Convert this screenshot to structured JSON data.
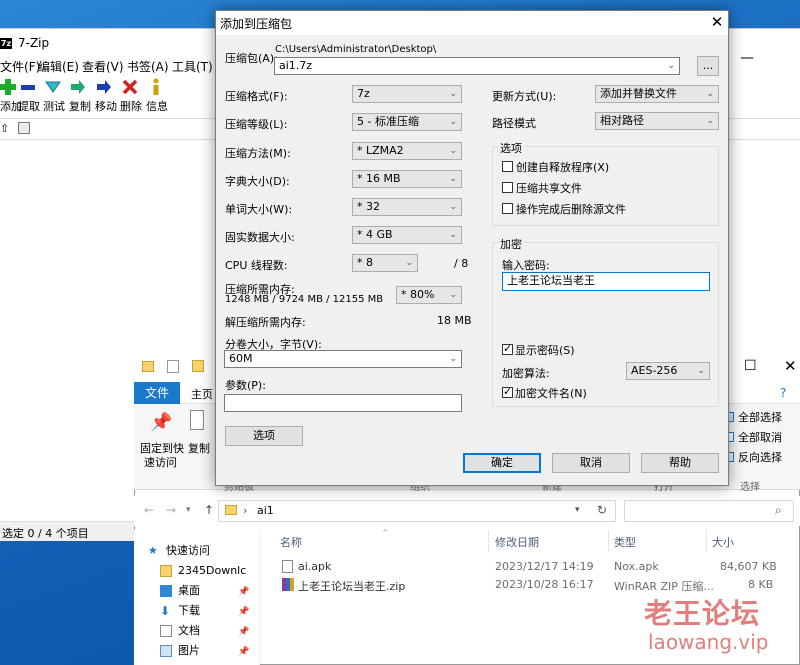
{
  "zip": {
    "title": "7-Zip",
    "menu": [
      "文件(F)",
      "编辑(E)",
      "查看(V)",
      "书签(A)",
      "工具(T)"
    ],
    "toolbar": [
      "添加",
      "提取",
      "测试",
      "复制",
      "移动",
      "删除",
      "信息"
    ],
    "status": "选定 0 / 4 个项目"
  },
  "dialog": {
    "title": "添加到压缩包",
    "archive_label": "压缩包(A):",
    "archive_path": "C:\\Users\\Administrator\\Desktop\\",
    "archive_name": "ai1.7z",
    "browse": "...",
    "left": [
      {
        "label": "压缩格式(F):",
        "value": "7z"
      },
      {
        "label": "压缩等级(L):",
        "value": "5 - 标准压缩"
      },
      {
        "label": "压缩方法(M):",
        "value": "* LZMA2"
      },
      {
        "label": "字典大小(D):",
        "value": "* 16 MB"
      },
      {
        "label": "单词大小(W):",
        "value": "* 32"
      },
      {
        "label": "固实数据大小:",
        "value": "* 4 GB"
      }
    ],
    "cpu_label": "CPU 线程数:",
    "cpu_value": "* 8",
    "cpu_max": "/ 8",
    "mem_label": "压缩所需内存:",
    "mem_detail": "1248 MB / 9724 MB / 12155 MB",
    "mem_pct": "* 80%",
    "unmem_label": "解压缩所需内存:",
    "unmem_value": "18 MB",
    "split_label": "分卷大小，字节(V):",
    "split_value": "60M",
    "params_label": "参数(P):",
    "params_value": "",
    "options_button": "选项",
    "update_label": "更新方式(U):",
    "update_value": "添加并替换文件",
    "path_label": "路径模式",
    "path_value": "相对路径",
    "options_group": "选项",
    "opt_sfx": "创建自释放程序(X)",
    "opt_shared": "压缩共享文件",
    "opt_delete": "操作完成后删除源文件",
    "enc_group": "加密",
    "pwd_label": "输入密码:",
    "pwd_value": "上老王论坛当老王",
    "show_pwd": "显示密码(S)",
    "enc_method_label": "加密算法:",
    "enc_method_value": "AES-256",
    "enc_names": "加密文件名(N)",
    "ok": "确定",
    "cancel": "取消",
    "help": "帮助"
  },
  "explorer": {
    "tab_file": "文件",
    "tab_home": "主页",
    "ribbon_pin": "固定到快",
    "ribbon_pin2": "速访问",
    "ribbon_copy": "复制",
    "sel_all": "全部选择",
    "sel_none": "全部取消",
    "sel_invert": "反向选择",
    "grp_clip": "剪贴板",
    "grp_org": "组织",
    "grp_new": "新建",
    "grp_open": "打开",
    "grp_sel": "选择",
    "path": "ai1",
    "sidebar": [
      {
        "label": "快速访问",
        "icon": "star-icon"
      },
      {
        "label": "2345Downlc",
        "icon": "folder-icon"
      },
      {
        "label": "桌面",
        "icon": "desktop-icon"
      },
      {
        "label": "下载",
        "icon": "download-icon"
      },
      {
        "label": "文档",
        "icon": "document-icon"
      },
      {
        "label": "图片",
        "icon": "picture-icon"
      }
    ],
    "columns": [
      "名称",
      "修改日期",
      "类型",
      "大小"
    ],
    "rows": [
      {
        "name": "ai.apk",
        "date": "2023/12/17 14:19",
        "type": "Nox.apk",
        "size": "84,607 KB"
      },
      {
        "name": "上老王论坛当老王.zip",
        "date": "2023/10/28 16:17",
        "type": "WinRAR ZIP 压缩...",
        "size": "8 KB"
      }
    ]
  },
  "watermark": {
    "line1": "老王论坛",
    "line2": "laowang.vip"
  }
}
